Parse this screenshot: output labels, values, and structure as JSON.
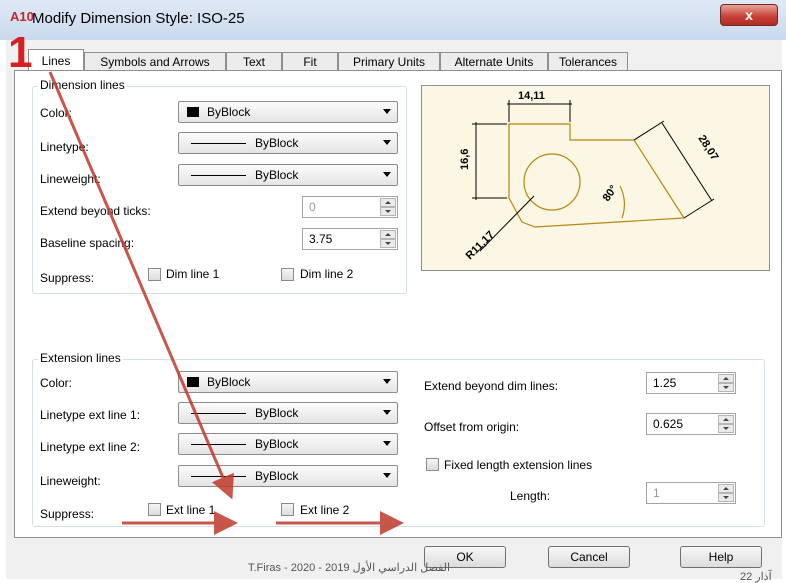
{
  "window": {
    "title": "Modify Dimension Style: ISO-25",
    "app_icon": "A10",
    "close_label": "x",
    "step_number": "1"
  },
  "tabs": [
    "Lines",
    "Symbols and Arrows",
    "Text",
    "Fit",
    "Primary Units",
    "Alternate Units",
    "Tolerances"
  ],
  "dimension_lines": {
    "legend": "Dimension lines",
    "color_label": "Color:",
    "color_value": "ByBlock",
    "linetype_label": "Linetype:",
    "linetype_value": "ByBlock",
    "lineweight_label": "Lineweight:",
    "lineweight_value": "ByBlock",
    "extend_label": "Extend beyond ticks:",
    "extend_value": "0",
    "baseline_label": "Baseline spacing:",
    "baseline_value": "3.75",
    "suppress_label": "Suppress:",
    "dim_line_1": "Dim line 1",
    "dim_line_2": "Dim line 2"
  },
  "preview": {
    "dim_top": "14,11",
    "dim_left": "16,6",
    "dim_right": "28,07",
    "dim_angle": "80°",
    "dim_radius": "R11,17"
  },
  "extension_lines": {
    "legend": "Extension lines",
    "color_label": "Color:",
    "color_value": "ByBlock",
    "linetype1_label": "Linetype ext line 1:",
    "linetype1_value": "ByBlock",
    "linetype2_label": "Linetype ext line 2:",
    "linetype2_value": "ByBlock",
    "lineweight_label": "Lineweight:",
    "lineweight_value": "ByBlock",
    "suppress_label": "Suppress:",
    "ext_line_1": "Ext line 1",
    "ext_line_2": "Ext line 2",
    "extend_beyond_label": "Extend beyond dim lines:",
    "extend_beyond_value": "1.25",
    "offset_label": "Offset from origin:",
    "offset_value": "0.625",
    "fixed_length_label": "Fixed length extension lines",
    "length_label": "Length:",
    "length_value": "1"
  },
  "buttons": {
    "ok": "OK",
    "cancel": "Cancel",
    "help": "Help"
  },
  "footer": {
    "text": "T.Firas  -  2020 - الفصل الدراسي الأول 2019",
    "page": "آذار 22"
  },
  "colors": {
    "annotation_red": "#c0392b",
    "preview_bg": "#fbf7e4",
    "preview_line": "#b8860b"
  }
}
